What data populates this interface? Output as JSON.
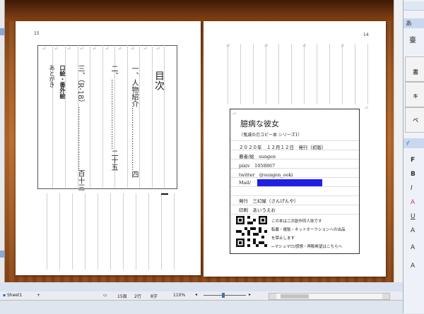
{
  "left_page": {
    "page_number": "15",
    "toc_title": "目次",
    "toc_items": [
      "一、人物紹介………………………四",
      "二、…………………………二十五",
      "三、（R‐18）………………………百十三",
      "口絵・番外絵",
      "あとがき"
    ]
  },
  "right_page": {
    "page_number": "14",
    "colophon": {
      "title": "臆病な彼女",
      "subtitle": "（鬼滅の刃コピー本 シリーズ1）",
      "date": "２０２０年　１２月１２日　発行（初版）",
      "author": "著者/絵　sungen",
      "pixiv": "pixiv　1058867",
      "twitter": "twitter　@sungen_ooki",
      "mail": "Mail/",
      "publisher": "発行　三幻屋（さんげんや）",
      "printer": "印刷　あいうえお",
      "notice_1": "この本は二次創作同人誌です",
      "notice_2": "転載・複製・ネットオークションへの出品",
      "notice_3": "を禁止します",
      "notice_4": "←マシュマロ/感想・再販希望はこちらへ"
    }
  },
  "pilcrow": "⏎",
  "status_bar": {
    "sheet_tab": "Sheet1",
    "add_sheet": "+",
    "page_count": "15頁",
    "line": "2行",
    "column": "8字",
    "zoom": "110%"
  },
  "sidebar": {
    "items": [
      "臺",
      "書",
      "記",
      "キ",
      "ペ"
    ],
    "palette_labels": [
      "F",
      "B",
      "I",
      "A",
      "U",
      "A",
      "A",
      "A"
    ],
    "header_a": "あ",
    "header_b": "ｲ"
  },
  "colors": {
    "mask_blue": "#1f1fe6",
    "wood_mid": "#b8692a",
    "accent": "#2a5fb0"
  }
}
